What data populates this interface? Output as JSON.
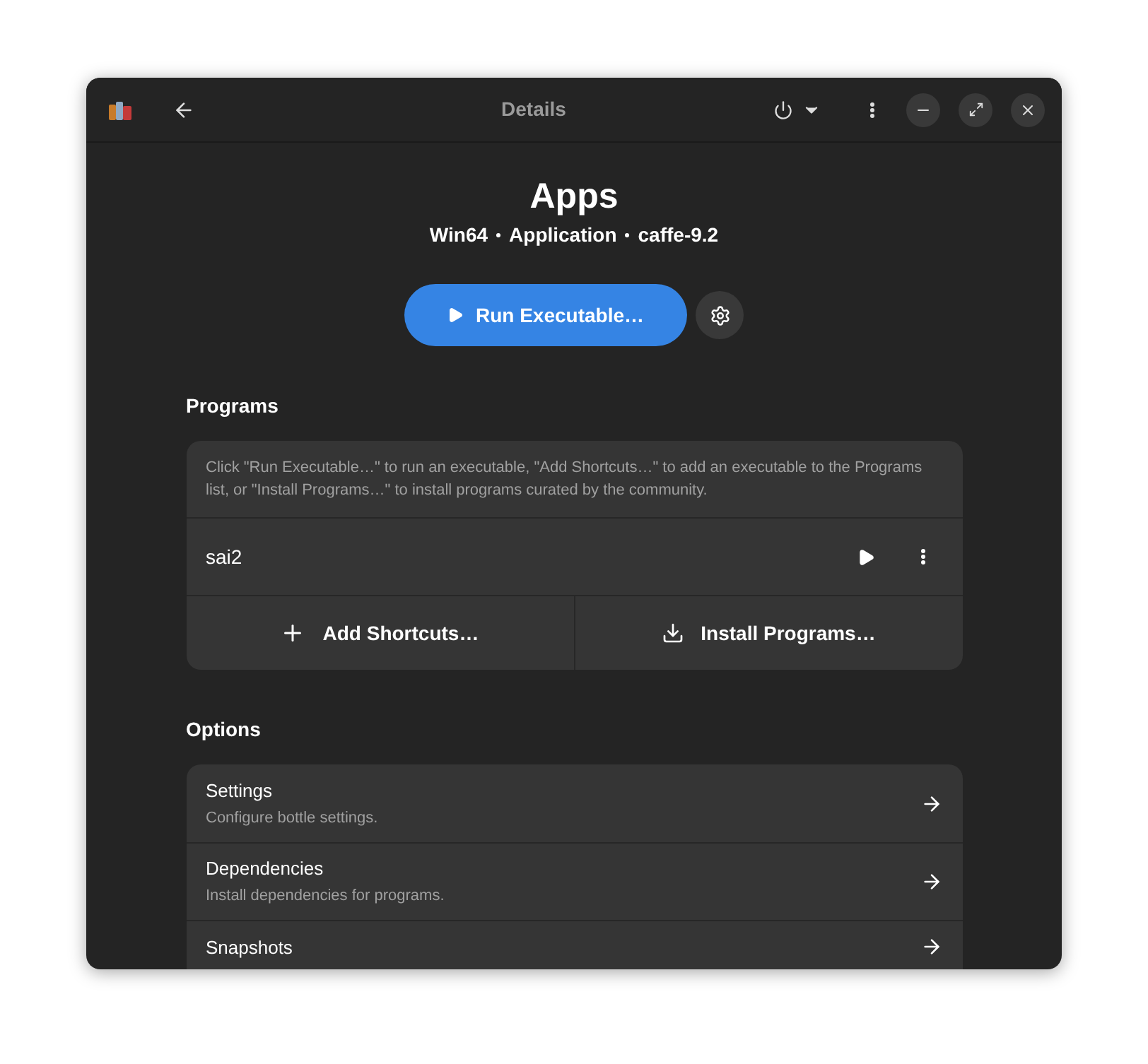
{
  "header": {
    "title": "Details"
  },
  "bottle": {
    "name": "Apps",
    "meta": [
      "Win64",
      "Application",
      "caffe-9.2"
    ],
    "run_button": "Run Executable…"
  },
  "programs": {
    "heading": "Programs",
    "hint": "Click \"Run Executable…\" to run an executable, \"Add Shortcuts…\" to add an executable to the Programs list, or \"Install Programs…\" to install programs curated by the community.",
    "items": [
      {
        "name": "sai2"
      }
    ],
    "actions": [
      {
        "kind": "add",
        "label": "Add Shortcuts…"
      },
      {
        "kind": "install",
        "label": "Install Programs…"
      }
    ]
  },
  "options": {
    "heading": "Options",
    "items": [
      {
        "title": "Settings",
        "subtitle": "Configure bottle settings."
      },
      {
        "title": "Dependencies",
        "subtitle": "Install dependencies for programs."
      },
      {
        "title": "Snapshots"
      }
    ]
  }
}
